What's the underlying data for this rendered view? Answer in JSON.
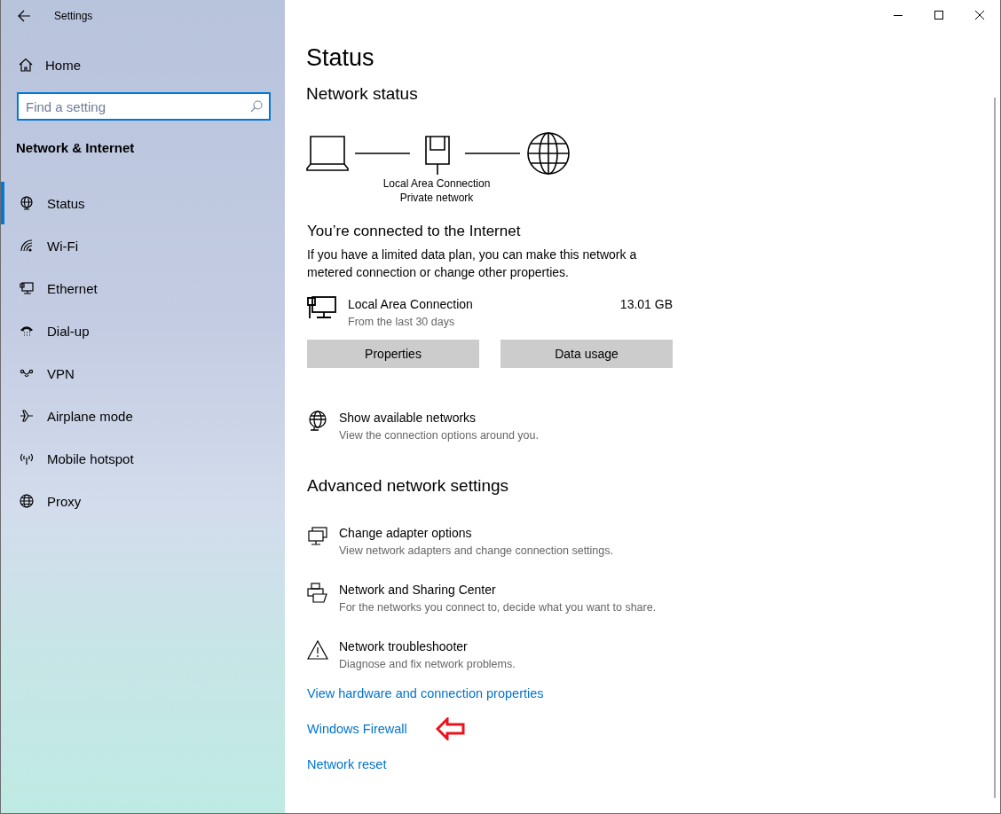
{
  "window": {
    "title": "Settings"
  },
  "sidebar": {
    "home": "Home",
    "search": {
      "placeholder": "Find a setting"
    },
    "section": "Network & Internet",
    "items": [
      {
        "label": "Status",
        "selected": true
      },
      {
        "label": "Wi-Fi",
        "selected": false
      },
      {
        "label": "Ethernet",
        "selected": false
      },
      {
        "label": "Dial-up",
        "selected": false
      },
      {
        "label": "VPN",
        "selected": false
      },
      {
        "label": "Airplane mode",
        "selected": false
      },
      {
        "label": "Mobile hotspot",
        "selected": false
      },
      {
        "label": "Proxy",
        "selected": false
      }
    ]
  },
  "main": {
    "title": "Status",
    "network_status": {
      "heading": "Network status",
      "adapter_label": "Local Area Connection",
      "network_type": "Private network"
    },
    "connection": {
      "heading": "You’re connected to the Internet",
      "text": "If you have a limited data plan, you can make this network a metered connection or change other properties.",
      "adapter": {
        "name": "Local Area Connection",
        "period": "From the last 30 days",
        "usage": "13.01 GB"
      },
      "buttons": [
        "Properties",
        "Data usage"
      ]
    },
    "show_networks": {
      "title": "Show available networks",
      "description": "View the connection options around you."
    },
    "advanced": {
      "heading": "Advanced network settings",
      "items": [
        {
          "title": "Change adapter options",
          "description": "View network adapters and change connection settings."
        },
        {
          "title": "Network and Sharing Center",
          "description": "For the networks you connect to, decide what you want to share."
        },
        {
          "title": "Network troubleshooter",
          "description": "Diagnose and fix network problems."
        }
      ],
      "links": [
        "View hardware and connection properties",
        "Windows Firewall",
        "Network reset"
      ]
    }
  }
}
